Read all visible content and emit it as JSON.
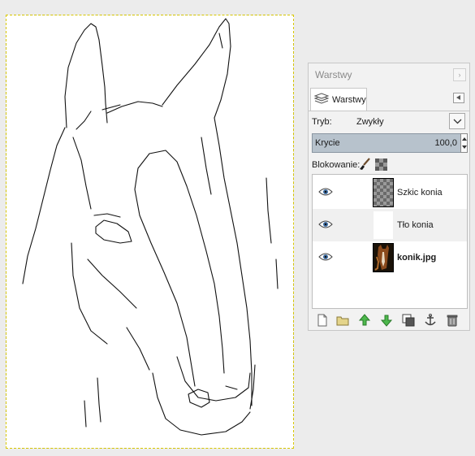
{
  "panel": {
    "title": "Warstwy",
    "tab_label": "Warstwy",
    "mode_label": "Tryb:",
    "mode_value": "Zwykły",
    "opacity_label": "Krycie",
    "opacity_value": "100,0",
    "lock_label": "Blokowanie:"
  },
  "layers": [
    {
      "name": "Szkic konia",
      "thumbnail": "transparent-checker",
      "visible": true,
      "bold": false
    },
    {
      "name": "Tło konia",
      "thumbnail": "white",
      "visible": true,
      "bold": false
    },
    {
      "name": "konik.jpg",
      "thumbnail": "horse-photo",
      "visible": true,
      "bold": true
    }
  ],
  "icons": {
    "tab": "layers-stack-icon",
    "visibility": "eye-icon",
    "lock_pixels": "paintbrush-icon",
    "lock_alpha": "checkerboard-icon",
    "toolbar": [
      "new-layer-icon",
      "new-layer-group-icon",
      "raise-layer-icon",
      "lower-layer-icon",
      "duplicate-layer-icon",
      "anchor-layer-icon",
      "delete-layer-icon"
    ]
  },
  "colors": {
    "opacity_bar": "#b7c2cc",
    "selection_border": "#d8c800",
    "raise_arrow": "#3aa63a",
    "lower_arrow": "#3aa63a"
  }
}
